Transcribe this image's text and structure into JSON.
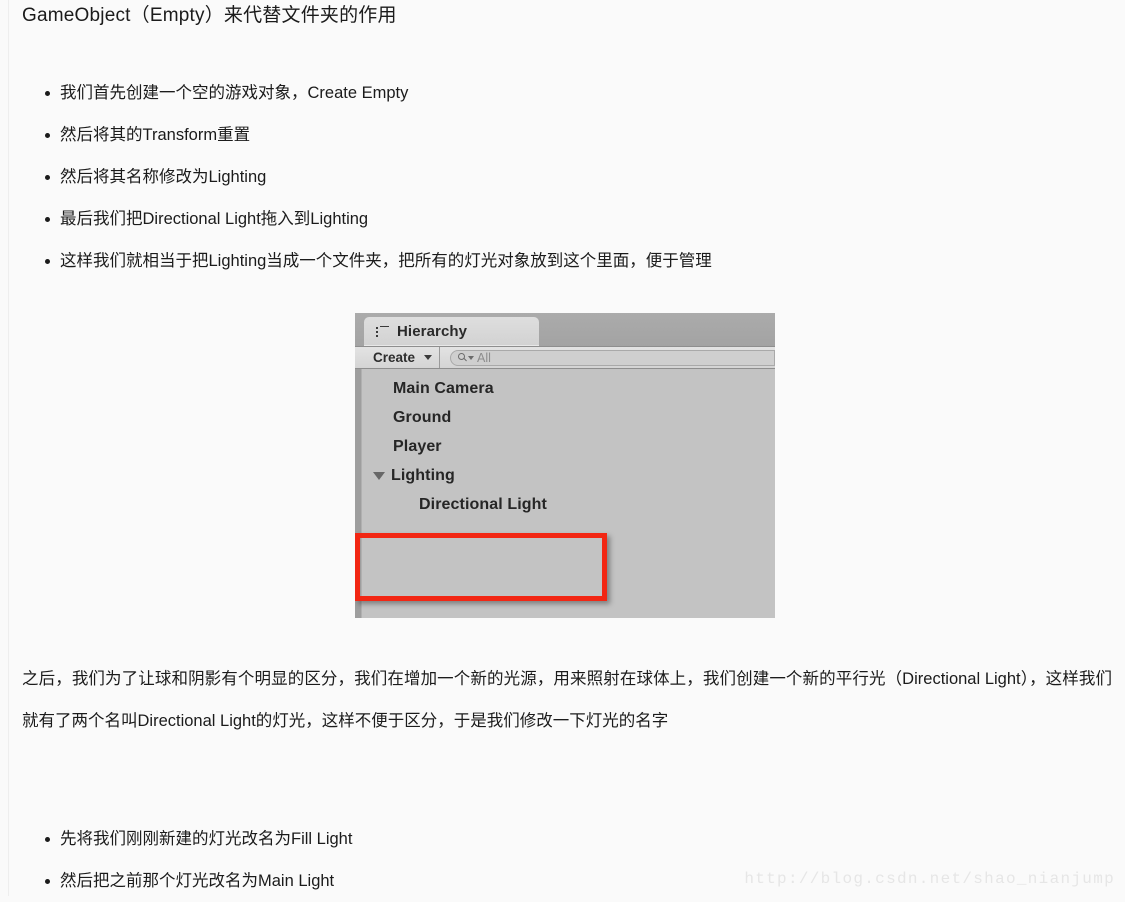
{
  "page": {
    "title": "GameObject（Empty）来代替文件夹的作用",
    "watermark": "http://blog.csdn.net/shao_nianjump"
  },
  "bullets_first": [
    "我们首先创建一个空的游戏对象，Create Empty",
    "然后将其的Transform重置",
    "然后将其名称修改为Lighting",
    "最后我们把Directional Light拖入到Lighting",
    "这样我们就相当于把Lighting当成一个文件夹，把所有的灯光对象放到这个里面，便于管理"
  ],
  "paragraph": "之后，我们为了让球和阴影有个明显的区分，我们在增加一个新的光源，用来照射在球体上，我们创建一个新的平行光（Directional Light），这样我们就有了两个名叫Directional Light的灯光，这样不便于区分，于是我们修改一下灯光的名字",
  "bullets_second": [
    "先将我们刚刚新建的灯光改名为Fill Light",
    "然后把之前那个灯光改名为Main Light"
  ],
  "unity_panel": {
    "tab_label": "Hierarchy",
    "tab_icon": "list-icon",
    "toolbar": {
      "create_label": "Create",
      "create_caret": "chevron-down-icon",
      "search_icon": "search-icon",
      "search_value": "All"
    },
    "tree": [
      {
        "label": "Main Camera",
        "depth": 0,
        "expandable": false
      },
      {
        "label": "Ground",
        "depth": 0,
        "expandable": false
      },
      {
        "label": "Player",
        "depth": 0,
        "expandable": false
      },
      {
        "label": "Lighting",
        "depth": 0,
        "expandable": true,
        "expanded": true
      },
      {
        "label": "Directional Light",
        "depth": 1,
        "expandable": false
      }
    ],
    "highlight_color": "#f22613"
  }
}
